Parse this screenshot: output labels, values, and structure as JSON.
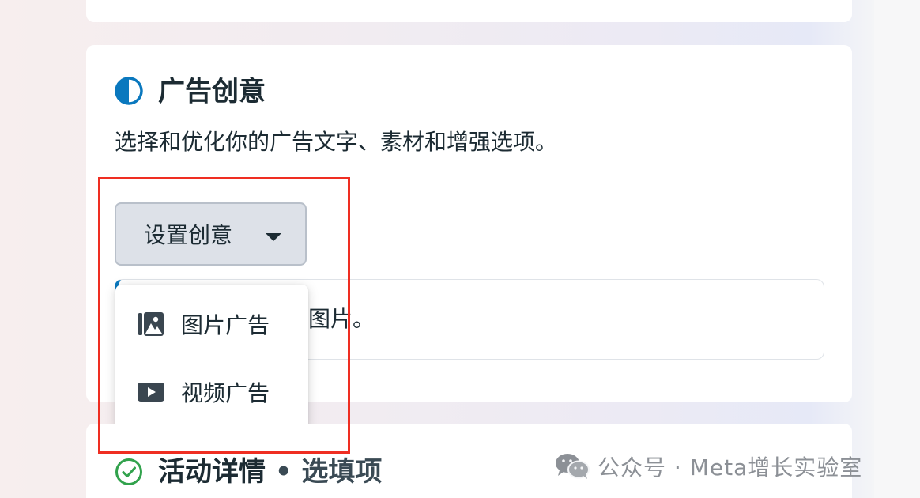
{
  "theme": {
    "accent": "#0a78be",
    "text": "#1c2b33",
    "button_bg": "#dde1e8",
    "highlight": "#ef2e22",
    "success": "#31a24c"
  },
  "ad_creative": {
    "title": "广告创意",
    "icon": "half-circle-icon",
    "description": "选择和优化你的广告文字、素材和增强选项。",
    "setup_button_label": "设置创意",
    "info_text": "图片。"
  },
  "dropdown": {
    "items": [
      {
        "label": "图片广告",
        "icon": "image-icon"
      },
      {
        "label": "视频广告",
        "icon": "video-icon"
      }
    ]
  },
  "activity_details": {
    "title": "活动详情",
    "separator": " • ",
    "optional_label": "选填项",
    "icon": "check-circle-icon"
  },
  "watermark": {
    "text": "公众号 · Meta增长实验室",
    "icon": "wechat-icon"
  }
}
